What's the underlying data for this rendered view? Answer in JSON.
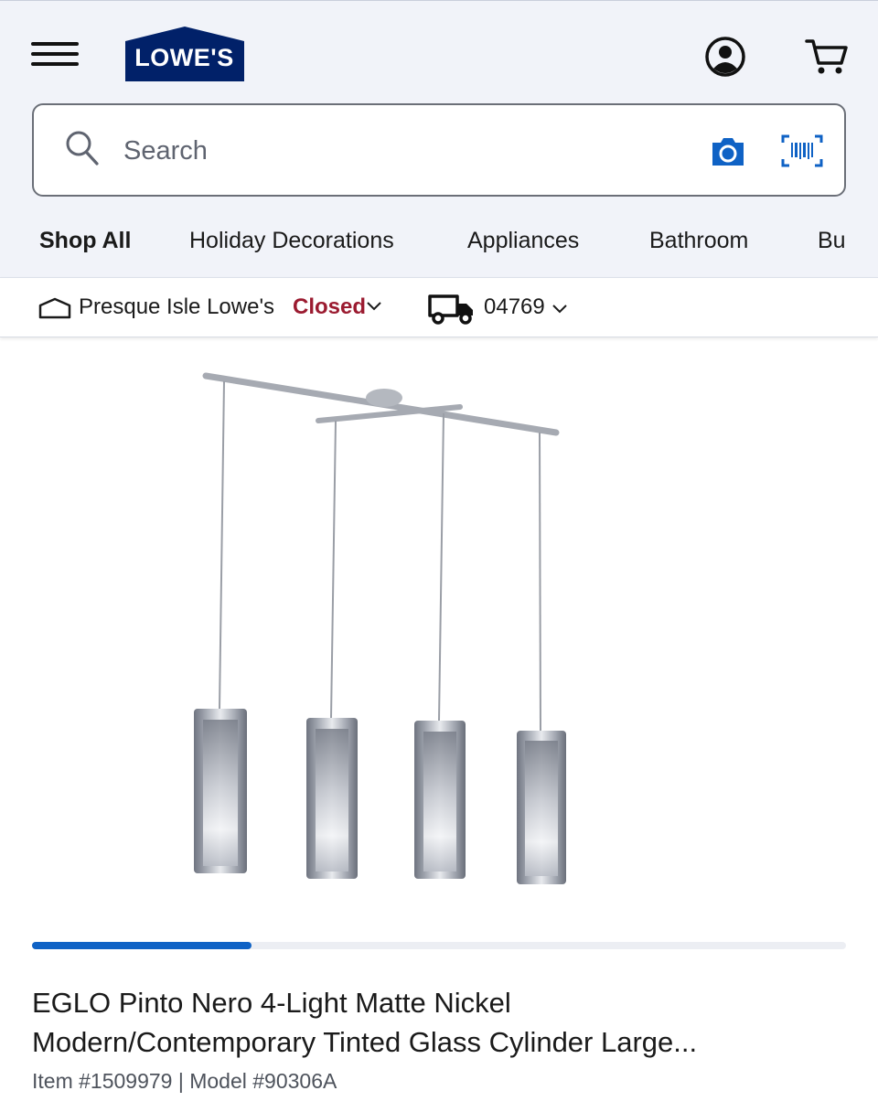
{
  "header": {
    "logo_text": "LOWE'S",
    "brand_color": "#012169",
    "accent_blue": "#0f62c5",
    "icons": [
      "menu-icon",
      "account-icon",
      "cart-icon"
    ]
  },
  "search": {
    "placeholder": "Search",
    "icons": [
      "search-icon",
      "camera-icon",
      "barcode-icon"
    ]
  },
  "nav": {
    "items": [
      "Shop All",
      "Holiday Decorations",
      "Appliances",
      "Bathroom",
      "Bu"
    ]
  },
  "store": {
    "name": "Presque Isle Lowe's",
    "status": "Closed",
    "status_color": "#9b1b30",
    "zip": "04769"
  },
  "carousel": {
    "progress_fraction": 0.27
  },
  "product": {
    "title_line1": "EGLO Pinto Nero 4-Light Matte Nickel",
    "title_line2": "Modern/Contemporary Tinted Glass Cylinder Large...",
    "item_number": "Item #1509979",
    "separator": "|",
    "model_number": "Model #90306A"
  }
}
